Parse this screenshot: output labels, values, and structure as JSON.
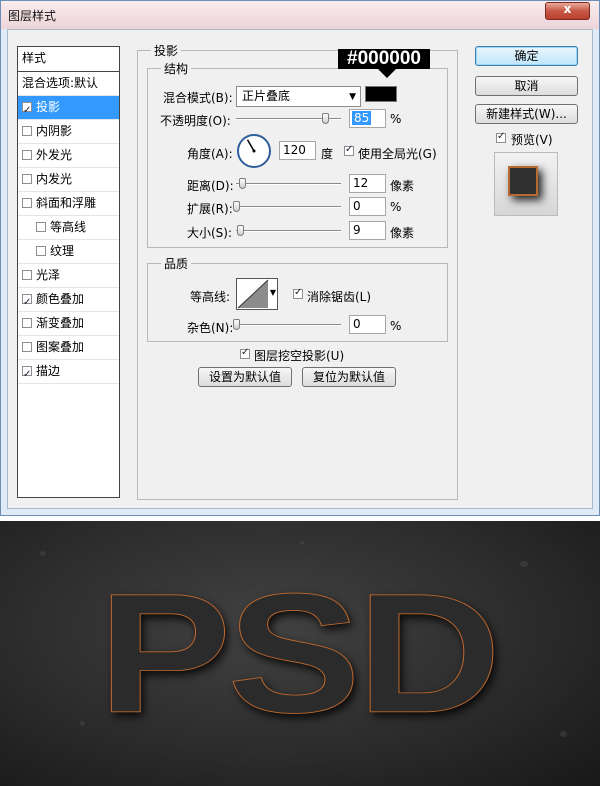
{
  "window": {
    "title": "图层样式",
    "close_label": "x"
  },
  "style_list": {
    "header": "样式",
    "items": [
      {
        "label": "混合选项:默认",
        "has_checkbox": false,
        "checked": false,
        "selected": false,
        "indent": false
      },
      {
        "label": "投影",
        "has_checkbox": true,
        "checked": true,
        "selected": true,
        "indent": false
      },
      {
        "label": "内阴影",
        "has_checkbox": true,
        "checked": false,
        "selected": false,
        "indent": false
      },
      {
        "label": "外发光",
        "has_checkbox": true,
        "checked": false,
        "selected": false,
        "indent": false
      },
      {
        "label": "内发光",
        "has_checkbox": true,
        "checked": false,
        "selected": false,
        "indent": false
      },
      {
        "label": "斜面和浮雕",
        "has_checkbox": true,
        "checked": false,
        "selected": false,
        "indent": false
      },
      {
        "label": "等高线",
        "has_checkbox": true,
        "checked": false,
        "selected": false,
        "indent": true
      },
      {
        "label": "纹理",
        "has_checkbox": true,
        "checked": false,
        "selected": false,
        "indent": true
      },
      {
        "label": "光泽",
        "has_checkbox": true,
        "checked": false,
        "selected": false,
        "indent": false
      },
      {
        "label": "颜色叠加",
        "has_checkbox": true,
        "checked": true,
        "selected": false,
        "indent": false
      },
      {
        "label": "渐变叠加",
        "has_checkbox": true,
        "checked": false,
        "selected": false,
        "indent": false
      },
      {
        "label": "图案叠加",
        "has_checkbox": true,
        "checked": false,
        "selected": false,
        "indent": false
      },
      {
        "label": "描边",
        "has_checkbox": true,
        "checked": true,
        "selected": false,
        "indent": false
      }
    ]
  },
  "drop_shadow": {
    "section_title": "投影",
    "structure": {
      "title": "结构",
      "blend_mode_label": "混合模式(B):",
      "blend_mode_value": "正片叠底",
      "shadow_color": "#000000",
      "color_tooltip": "#000000",
      "opacity_label": "不透明度(O):",
      "opacity_value": "85",
      "opacity_fraction": 0.85,
      "opacity_unit": "%",
      "angle_label": "角度(A):",
      "angle_value": "120",
      "angle_degrees": 120,
      "angle_unit": "度",
      "global_light_label": "使用全局光(G)",
      "global_light_checked": true,
      "distance_label": "距离(D):",
      "distance_value": "12",
      "distance_fraction": 0.06,
      "distance_unit": "像素",
      "spread_label": "扩展(R):",
      "spread_value": "0",
      "spread_fraction": 0,
      "spread_unit": "%",
      "size_label": "大小(S):",
      "size_value": "9",
      "size_fraction": 0.04,
      "size_unit": "像素"
    },
    "quality": {
      "title": "品质",
      "contour_label": "等高线:",
      "anti_alias_label": "消除锯齿(L)",
      "anti_alias_checked": true,
      "noise_label": "杂色(N):",
      "noise_value": "0",
      "noise_fraction": 0,
      "noise_unit": "%"
    },
    "knockout_label": "图层挖空投影(U)",
    "knockout_checked": true,
    "make_default_label": "设置为默认值",
    "reset_default_label": "复位为默认值"
  },
  "buttons": {
    "ok": "确定",
    "cancel": "取消",
    "new_style": "新建样式(W)...",
    "preview_label": "预览(V)",
    "preview_checked": true
  },
  "canvas_preview": {
    "text": "PSD",
    "text_fill": "#2b2b2b",
    "stroke_color": "#c26a2d",
    "background": "#2e2e2e"
  }
}
